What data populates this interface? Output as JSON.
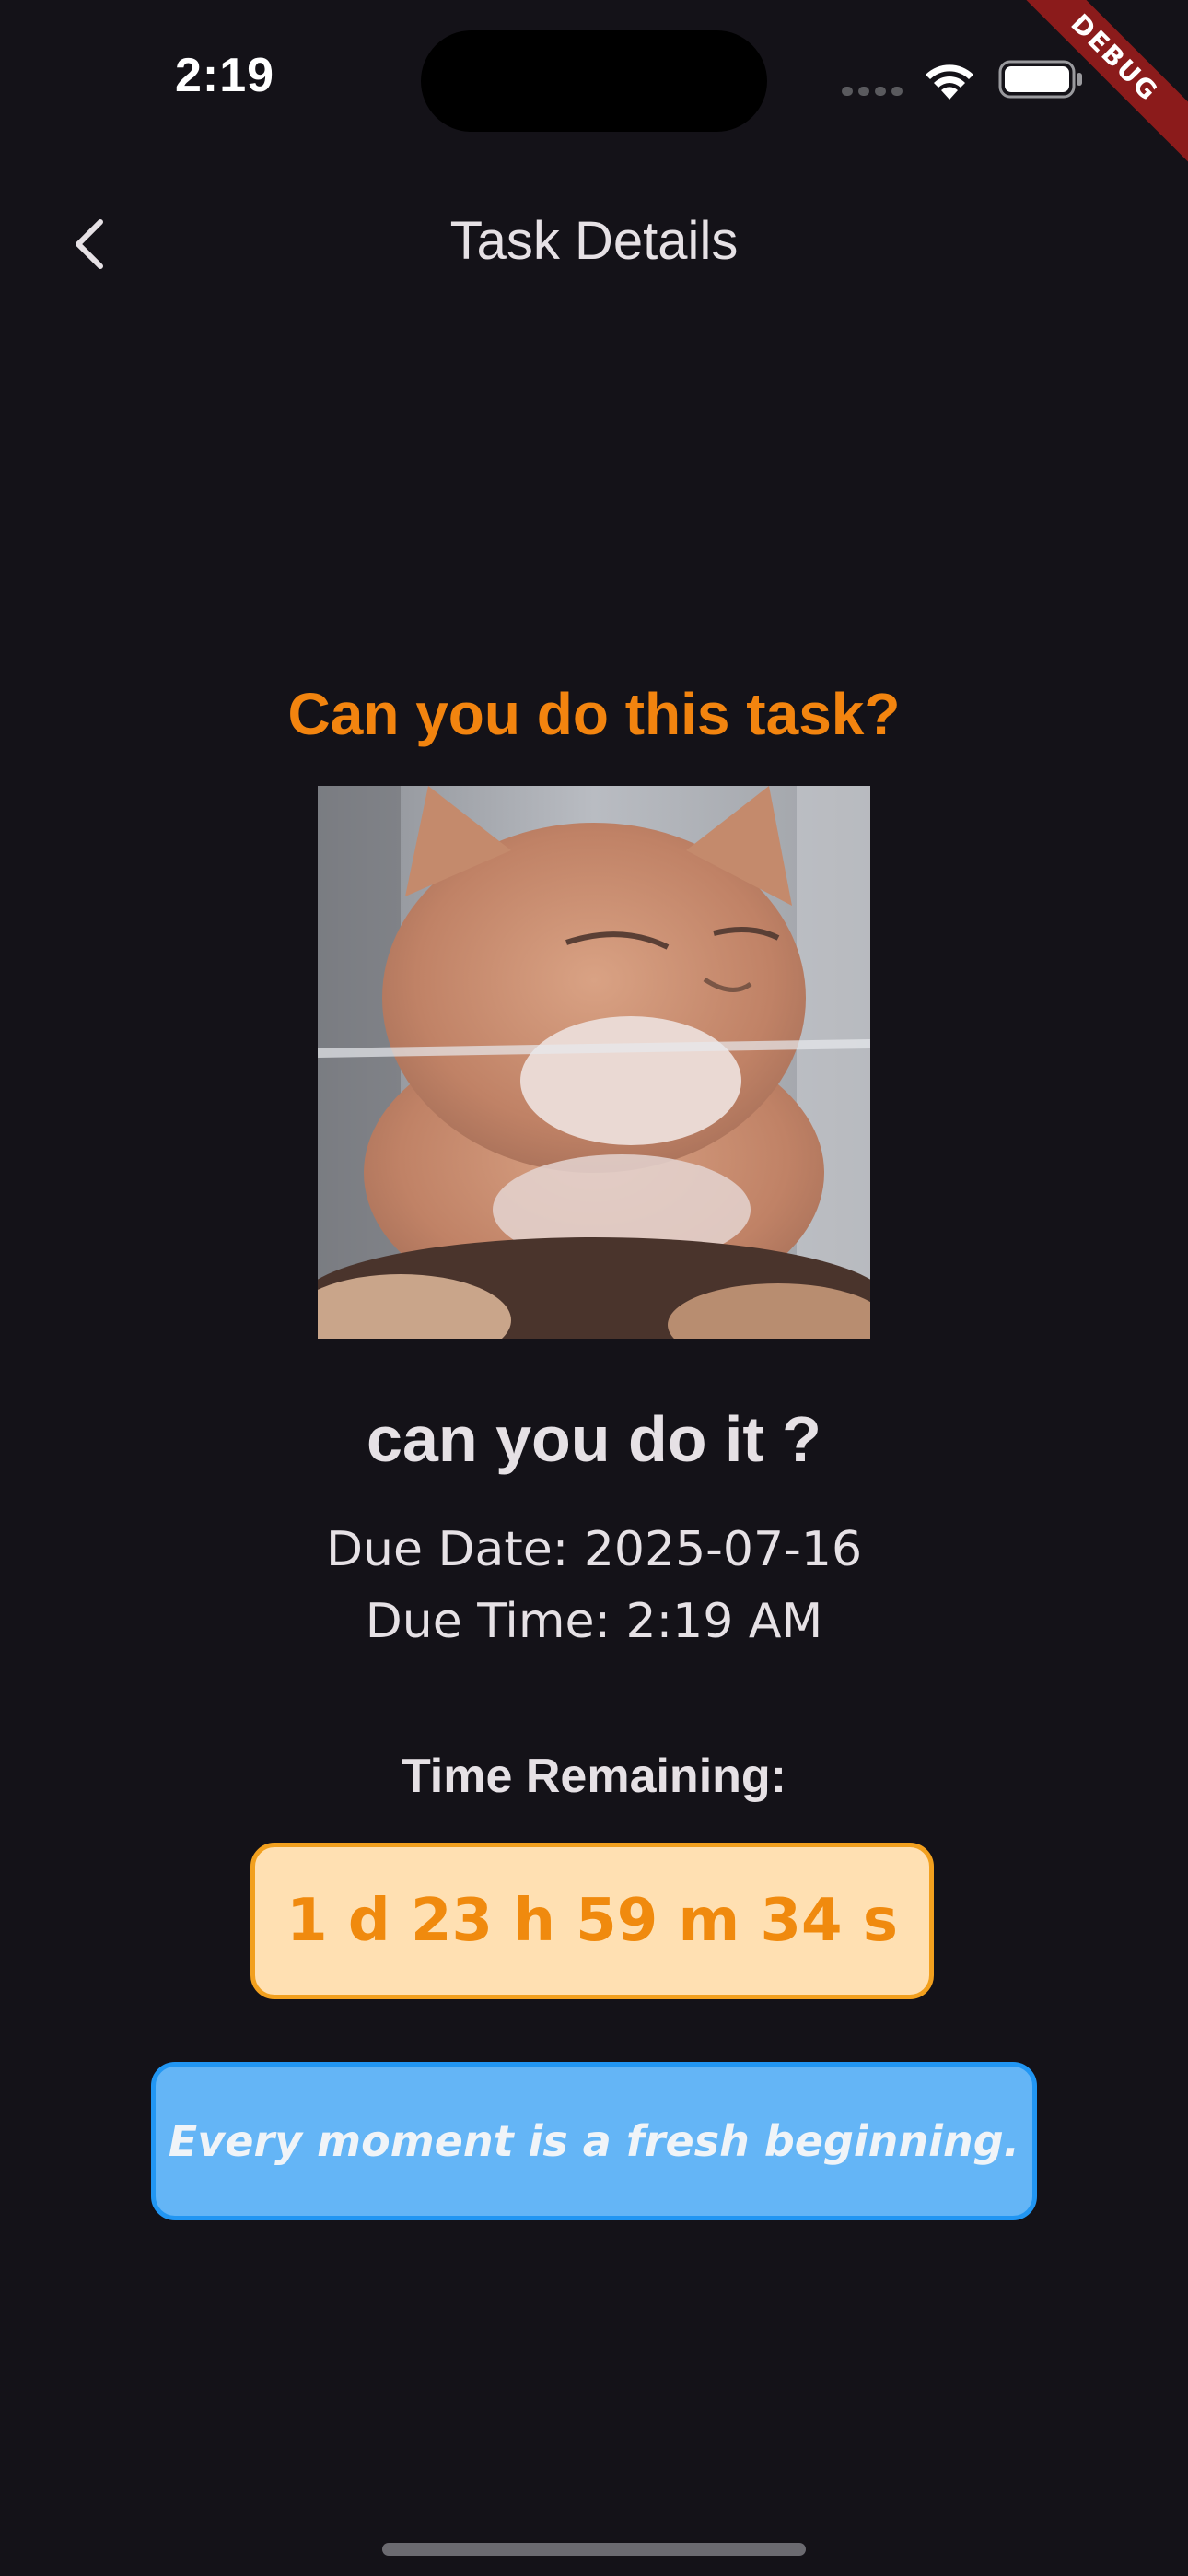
{
  "status_bar": {
    "time": "2:19",
    "icons": [
      "cellular-signal-icon",
      "wifi-icon",
      "battery-icon"
    ]
  },
  "debug_banner": "DEBUG",
  "app_bar": {
    "back_icon": "chevron-left-icon",
    "title": "Task Details"
  },
  "content": {
    "heading": "Can you do this task?",
    "image_subject": "orange-cat-photo",
    "task_title": "can you do it ?",
    "due_date": "Due Date: 2025-07-16",
    "due_time": "Due Time: 2:19 AM",
    "remaining_label": "Time Remaining:",
    "countdown": "1 d 23 h 59 m 34 s",
    "quote": "Every moment is a fresh beginning."
  },
  "colors": {
    "background": "#141218",
    "heading": "#F2840F",
    "countdown_bg": "#FFE0B2",
    "countdown_border": "#F2A01E",
    "countdown_text": "#F08A0E",
    "quote_bg": "#64B5F6",
    "quote_border": "#2196F3",
    "debug_banner": "#8B1B1B"
  }
}
